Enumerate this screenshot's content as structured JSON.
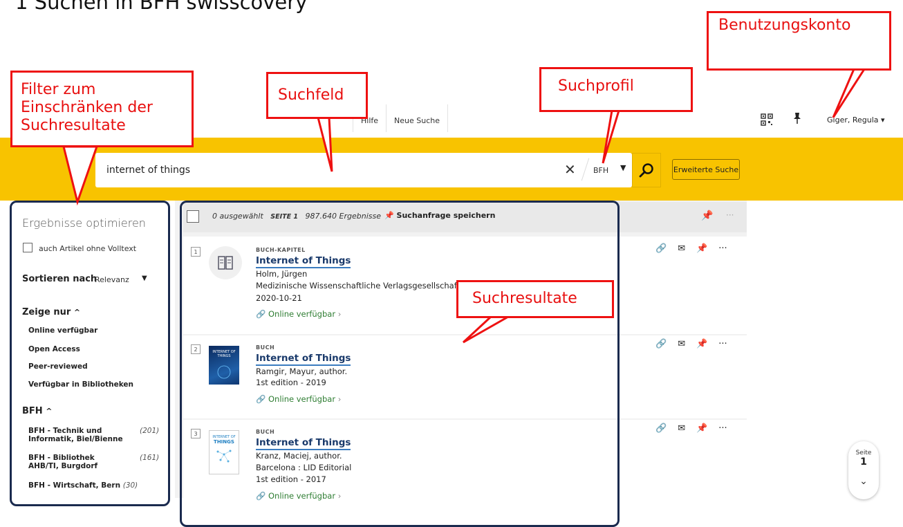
{
  "slide_title": "1 Suchen in BFH swisscovery",
  "callouts": {
    "benutzungskonto": "Benutzungskonto",
    "filter": "Filter zum Einschränken der Suchresultate",
    "suchfeld": "Suchfeld",
    "suchprofil": "Suchprofil",
    "suchresultate": "Suchresultate"
  },
  "topnav": {
    "help": "Hilfe",
    "new_search": "Neue Suche",
    "user": "Giger, Regula"
  },
  "search": {
    "query": "internet of things",
    "profile": "BFH",
    "advanced": "Erweiterte Suche"
  },
  "filters": {
    "title": "Ergebnisse optimieren",
    "fulltext_label": "auch Artikel ohne Volltext",
    "sort_label": "Sortieren nach",
    "sort_value": "Relevanz",
    "show_only_heading": "Zeige nur",
    "show_only": [
      "Online verfügbar",
      "Open Access",
      "Peer-reviewed",
      "Verfügbar in Bibliotheken"
    ],
    "bfh_heading": "BFH",
    "bfh": [
      {
        "label": "BFH - Technik und Informatik, Biel/Bienne",
        "count": "(201)"
      },
      {
        "label": "BFH - Bibliothek AHB/TI, Burgdorf",
        "count": "(161)"
      },
      {
        "label": "BFH - Wirtschaft, Bern",
        "count": "(30)"
      }
    ]
  },
  "results_header": {
    "selected": "0 ausgewählt",
    "page": "SEITE 1",
    "count": "987.640 Ergebnisse",
    "save": "Suchanfrage speichern"
  },
  "results": [
    {
      "num": "1",
      "type": "BUCH-KAPITEL",
      "title": "Internet of Things",
      "author": "Holm, Jürgen",
      "publisher": "Medizinische Wissenschaftliche Verlagsgesellschaft",
      "date": "2020-10-21",
      "availability": "Online verfügbar"
    },
    {
      "num": "2",
      "type": "BUCH",
      "title": "Internet of Things",
      "author": "Ramgir, Mayur, author.",
      "date": "1st edition - 2019",
      "availability": "Online verfügbar"
    },
    {
      "num": "3",
      "type": "BUCH",
      "title": "Internet of Things",
      "author": "Kranz, Maciej, author.",
      "publisher": "Barcelona : LID Editorial",
      "date": "1st edition - 2017",
      "availability": "Online verfügbar"
    }
  ],
  "pagenav": {
    "label": "Seite",
    "number": "1"
  },
  "colors": {
    "accent_yellow": "#f8c300",
    "callout_red": "#ee1111",
    "frame_navy": "#1a2a4e",
    "available_green": "#2e7d32"
  }
}
